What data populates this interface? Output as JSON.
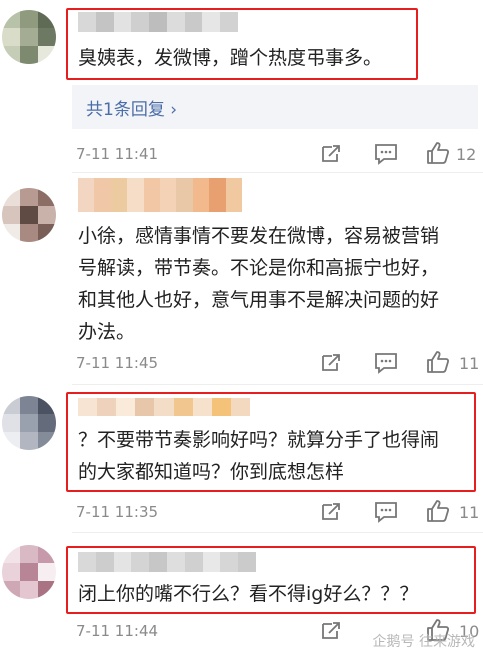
{
  "comments": [
    {
      "text": "臭姨表，发微博，蹭个热度弔事多。",
      "reply_label": "共1条回复 ›",
      "time": "7-11 11:41",
      "likes": "12",
      "avatar_colors": [
        "#b8c2a8",
        "#8f9a7e",
        "#5f6b55",
        "#d9dcc9",
        "#a4ad93",
        "#6d7962",
        "#c6cdb7",
        "#7e8a6f",
        "#e6e8dc"
      ]
    },
    {
      "text": "小徐，感情事情不要发在微博，容易被营销\n号解读，带节奏。不论是你和高振宁也好，\n和其他人也好，意气用事不是解决问题的好\n办法。",
      "time": "7-11 11:45",
      "likes": "11",
      "avatar_colors": [
        "#e9ded8",
        "#b79a92",
        "#8d6e66",
        "#d7c4bd",
        "#5f4a44",
        "#c9b2aa",
        "#f1ebe7",
        "#a88a82",
        "#7a5f58"
      ]
    },
    {
      "text": "？不要带节奏影响好吗？就算分手了也得闹\n的大家都知道吗？你到底想怎样",
      "time": "7-11 11:35",
      "likes": "11",
      "avatar_colors": [
        "#c9ccd3",
        "#7d8594",
        "#4b5362",
        "#dfe1e6",
        "#9aa1ae",
        "#646c7b",
        "#eceef1",
        "#b1b6c0",
        "#858c99"
      ]
    },
    {
      "text": "闭上你的嘴不行么？看不得ig好么？？？",
      "time": "7-11 11:44",
      "likes": "10",
      "avatar_colors": [
        "#f1e3e8",
        "#d8b9c4",
        "#c79aab",
        "#e9d2da",
        "#b88596",
        "#f7eef1",
        "#cfa8b6",
        "#e3c6d0",
        "#a97384"
      ]
    }
  ],
  "name_blur_colors": [
    [
      "#d8d8d8",
      "#c4c4c4",
      "#e2e2e2",
      "#cfcfcf",
      "#bdbdbd",
      "#dcdcdc",
      "#c9c9c9",
      "#e6e6e6",
      "#d2d2d2"
    ],
    [
      "#f3d6c2",
      "#f0c8a8",
      "#eccba0",
      "#f6ddc8",
      "#f1c7a6",
      "#f4d2b5",
      "#e9c8a8",
      "#f2b98c",
      "#e8a070",
      "#f0c9a0"
    ],
    [
      "#f7e4d2",
      "#efd2bc",
      "#f9ead9",
      "#e8c6a9",
      "#f3ddc6",
      "#f1c68f",
      "#f6e1cc",
      "#f5c27a",
      "#f2d9bf"
    ],
    [
      "#d9d9d9",
      "#cdcdcd",
      "#e4e4e4",
      "#d4d4d4",
      "#c7c7c7",
      "#dedede",
      "#d0d0d0",
      "#e8e8e8",
      "#d6d6d6",
      "#cbcbcb"
    ]
  ],
  "icons": [
    "share-icon",
    "comment-icon",
    "thumbs-up-icon"
  ],
  "watermark": "企鹅号 往来游戏",
  "colors": {
    "highlight_border": "#e61e1e",
    "reply_link": "#4c6ea8",
    "meta_text": "#8a8a8a"
  }
}
